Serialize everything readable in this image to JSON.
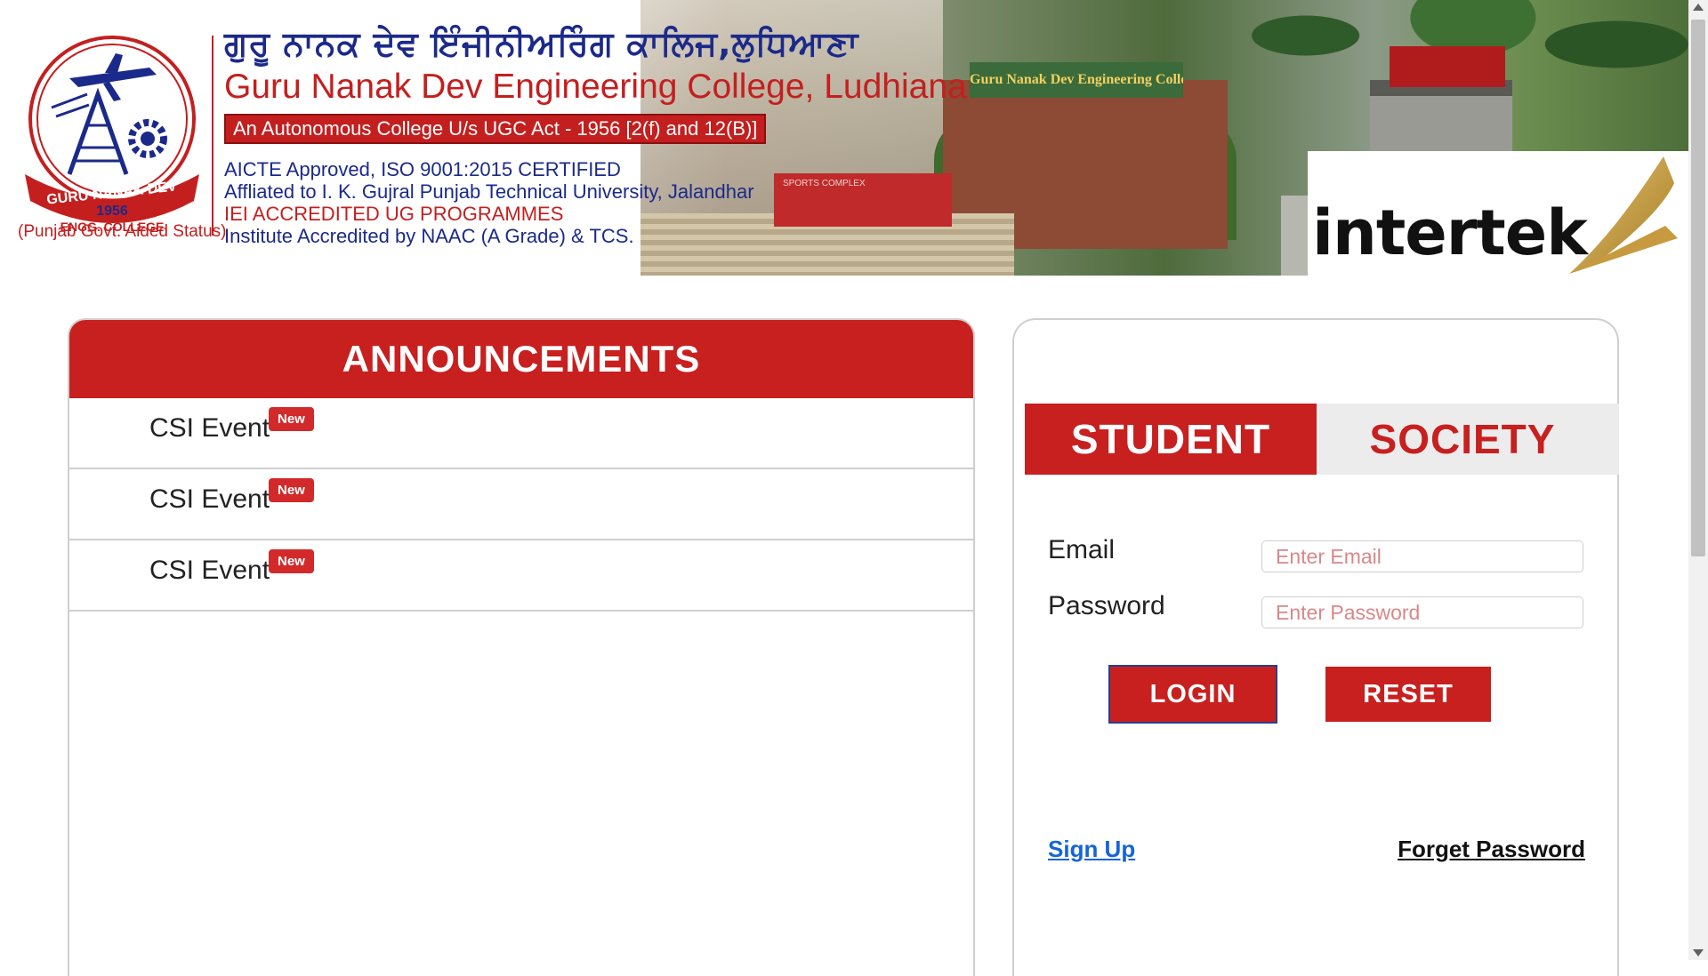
{
  "header": {
    "college_name_punjabi": "ਗੁਰੂ ਨਾਨਕ ਦੇਵ ਇੰਜੀਨੀਅਰਿੰਗ ਕਾਲਿਜ,ਲੁਧਿਆਣਾ",
    "college_name": "Guru Nanak Dev Engineering College, Ludhiana",
    "autonomous_line": "An Autonomous College U/s UGC Act - 1956 [2(f) and 12(B)]",
    "cert_lines": [
      "AICTE Approved, ISO 9001:2015 CERTIFIED",
      "Affliated to I. K. Gujral Punjab Technical University, Jalandhar",
      "IEI ACCREDITED UG PROGRAMMES",
      "Institute Accredited by NAAC (A Grade) & TCS."
    ],
    "logo": {
      "ring_text": "GURU NANAK DEV",
      "year": "1956",
      "ribbon_text": "ENGG. COLLEGE",
      "status": "(Punjab Govt. Aided Status)"
    },
    "photo_signs": {
      "building": "Guru Nanak Dev Engineering College",
      "sports": "SPORTS COMPLEX"
    },
    "partner_logo_text": "intertek",
    "brand_color": "#c81f1f",
    "navy_color": "#1b2a8a"
  },
  "announcements": {
    "title": "ANNOUNCEMENTS",
    "items": [
      {
        "text": "CSI Event",
        "badge": "New"
      },
      {
        "text": "CSI Event",
        "badge": "New"
      },
      {
        "text": "CSI Event",
        "badge": "New"
      }
    ]
  },
  "login": {
    "tabs": [
      {
        "label": "STUDENT",
        "active": true
      },
      {
        "label": "SOCIETY",
        "active": false
      }
    ],
    "email_label": "Email",
    "email_placeholder": "Enter Email",
    "email_value": "",
    "password_label": "Password",
    "password_placeholder": "Enter Password",
    "password_value": "",
    "login_button": "LOGIN",
    "reset_button": "RESET",
    "signup_link": "Sign Up",
    "forget_link": "Forget Password",
    "link_color": "#1565d8"
  }
}
